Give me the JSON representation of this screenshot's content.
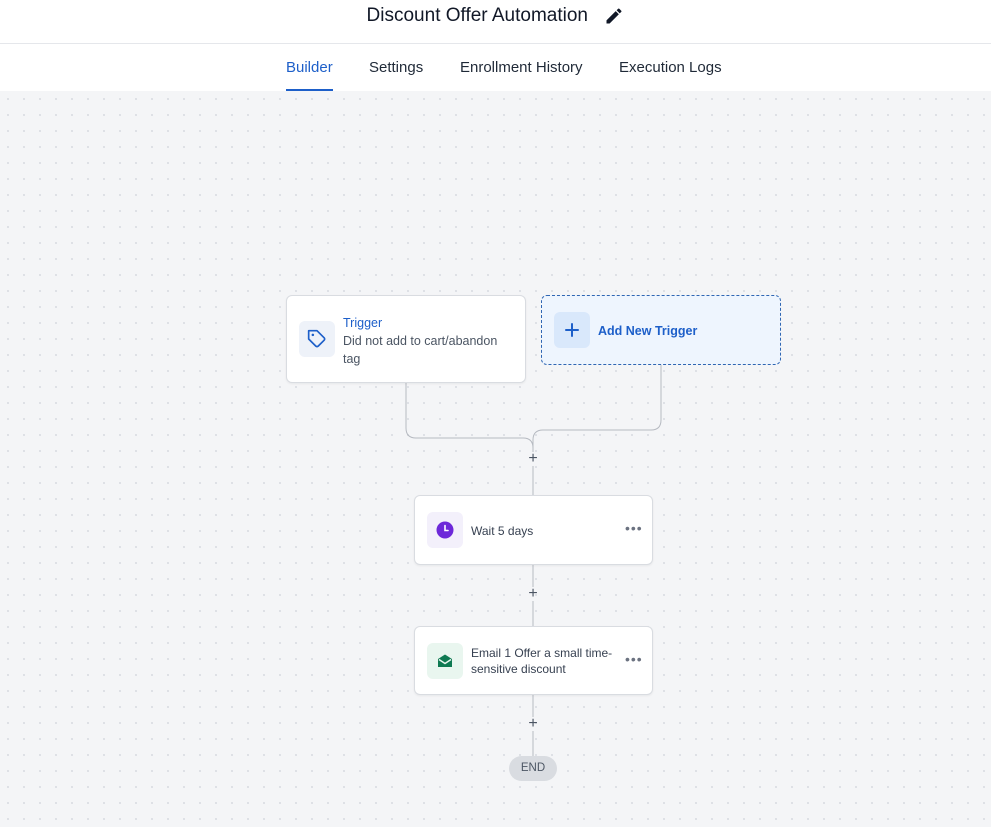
{
  "header": {
    "title": "Discount Offer Automation",
    "edit_icon": "pencil-icon"
  },
  "tabs": [
    {
      "label": "Builder",
      "active": true
    },
    {
      "label": "Settings",
      "active": false
    },
    {
      "label": "Enrollment History",
      "active": false
    },
    {
      "label": "Execution Logs",
      "active": false
    }
  ],
  "flow": {
    "trigger": {
      "title": "Trigger",
      "description": "Did not add to cart/abandon tag",
      "icon": "tag-icon"
    },
    "add_trigger": {
      "label": "Add New Trigger",
      "icon": "plus-icon"
    },
    "steps": [
      {
        "label": "Wait 5 days",
        "icon": "clock-icon"
      },
      {
        "label": "Email 1 Offer a small time-sensitive discount",
        "icon": "email-open-icon"
      }
    ],
    "end_label": "END",
    "add_step_symbol": "+"
  },
  "colors": {
    "accent": "#1d5fc9",
    "wait_icon": "#6d28d9",
    "email_icon": "#0f7a52",
    "canvas_bg": "#f4f5f7"
  }
}
